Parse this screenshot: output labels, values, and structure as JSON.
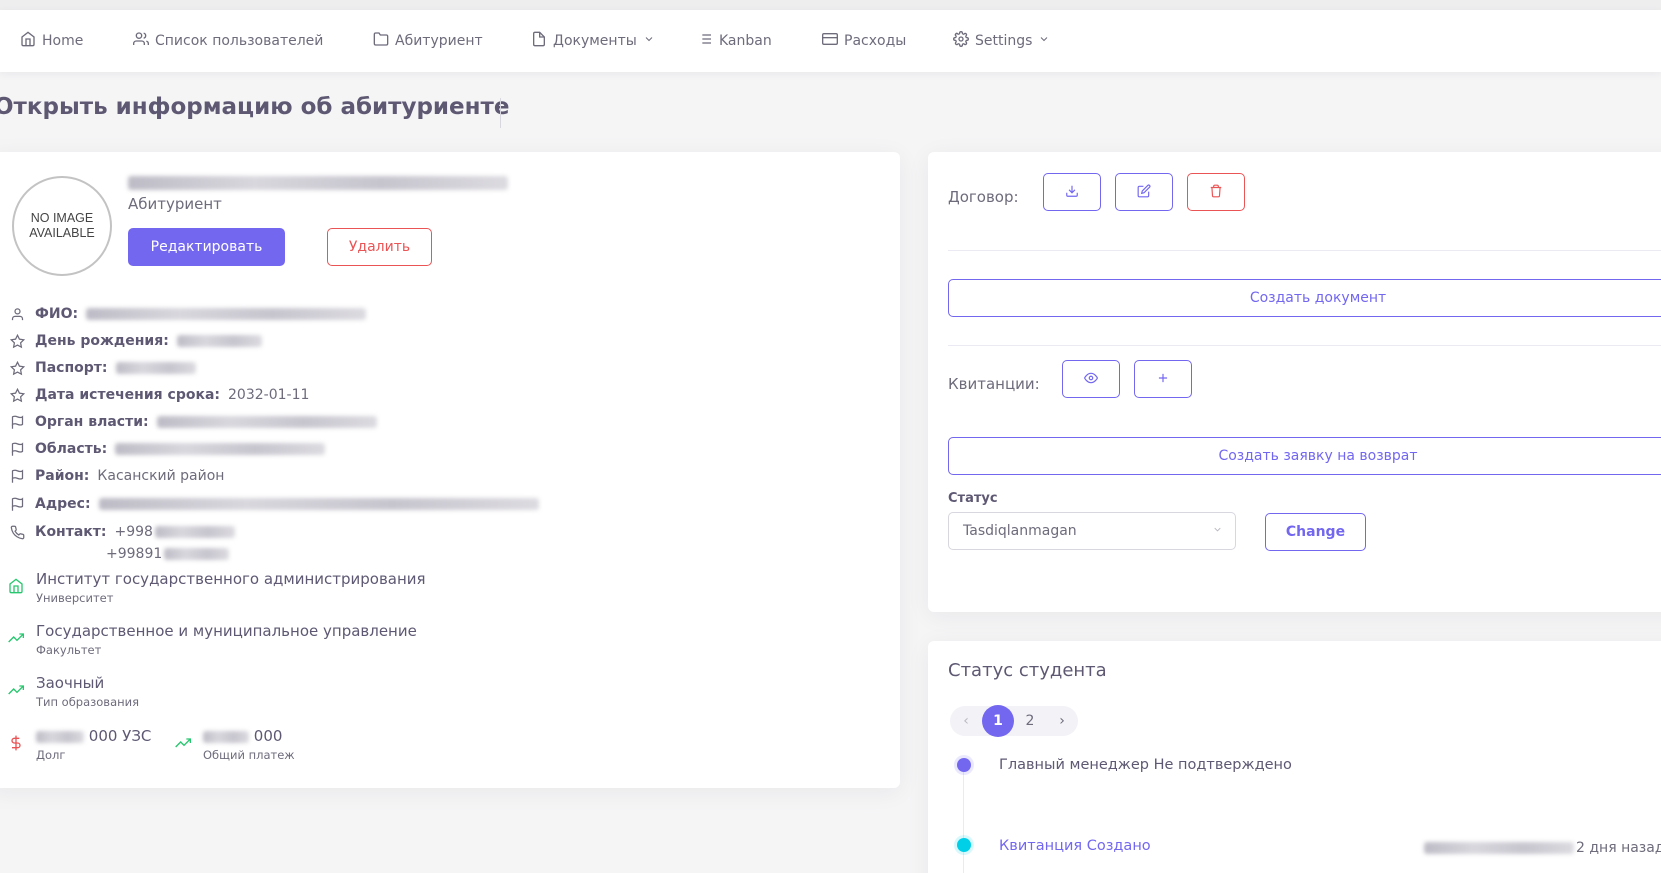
{
  "nav": {
    "items": [
      {
        "label": "Home",
        "icon": "home-icon"
      },
      {
        "label": "Список пользователей",
        "icon": "users-icon"
      },
      {
        "label": "Абитуриент",
        "icon": "folder-icon"
      },
      {
        "label": "Документы",
        "icon": "file-icon"
      },
      {
        "label": "Kanban",
        "icon": "list-icon"
      },
      {
        "label": "Расходы",
        "icon": "credit-card-icon"
      },
      {
        "label": "Settings",
        "icon": "gear-icon"
      }
    ]
  },
  "page": {
    "title": "Открыть информацию об абитуриенте"
  },
  "profile": {
    "avatar_text": "NO IMAGE AVAILABLE",
    "role": "Абитуриент",
    "edit_label": "Редактировать",
    "delete_label": "Удалить"
  },
  "fields": [
    {
      "label": "ФИО:",
      "value": ""
    },
    {
      "label": "День рождения:",
      "value": ""
    },
    {
      "label": "Паспорт:",
      "value": ""
    },
    {
      "label": "Дата истечения срока:",
      "value": "2032-01-11"
    },
    {
      "label": "Орган власти:",
      "value": ""
    },
    {
      "label": "Область:",
      "value": ""
    },
    {
      "label": "Район:",
      "value": "Касанский район"
    },
    {
      "label": "Адрес:",
      "value": ""
    },
    {
      "label": "Контакт:",
      "value": "+998",
      "value2": "+99891"
    }
  ],
  "education": {
    "university": {
      "value": "Институт государственного администрирования",
      "label": "Университет"
    },
    "faculty": {
      "value": "Государственное и муниципальное управление",
      "label": "Факультет"
    },
    "type": {
      "value": "Заочный",
      "label": "Тип образования"
    },
    "debt": {
      "value": "000 УЗС",
      "label": "Долг"
    },
    "total": {
      "value": "000",
      "label": "Общий платеж"
    }
  },
  "contract": {
    "label": "Договор:",
    "create_document": "Создать документ",
    "receipts_label": "Квитанции:",
    "create_refund": "Создать заявку на возврат",
    "status_label": "Статус",
    "status_value": "Tasdiqlanmagan",
    "change_label": "Change"
  },
  "student_status": {
    "title": "Статус студента",
    "pager": {
      "prev": "‹",
      "pages": [
        "1",
        "2"
      ],
      "active": "1",
      "next": "›"
    },
    "events": [
      {
        "text": "Главный менеджер Не подтверждено",
        "color": "#7367f0"
      },
      {
        "text": "Квитанция Создано",
        "color": "#00cfe8",
        "time": "2 дня назад"
      }
    ]
  },
  "colors": {
    "primary": "#7367f0",
    "danger": "#ea5455",
    "success": "#28c76f",
    "info": "#00cfe8"
  }
}
